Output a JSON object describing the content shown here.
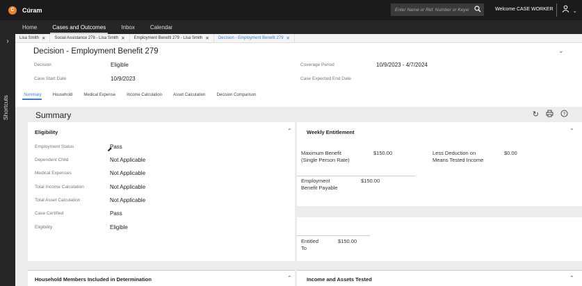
{
  "app": {
    "brand": "Cúram",
    "logo_letter": "C"
  },
  "search": {
    "placeholder": "Enter Name or Ref. Number or Keyw"
  },
  "user": {
    "welcome": "Welcome CASE WORKER",
    "icon": "user-icon"
  },
  "nav": {
    "items": [
      "Home",
      "Cases and Outcomes",
      "Inbox",
      "Calendar"
    ],
    "active": "Cases and Outcomes"
  },
  "rail": {
    "label": "Shortcuts"
  },
  "tabs": [
    {
      "label": "Lisa Smith"
    },
    {
      "label": "Social Assistance 278 - Lisa Smith"
    },
    {
      "label": "Employment Benefit 279 - Lisa Smith"
    },
    {
      "label": "Decision - Employment Benefit 279"
    }
  ],
  "header": {
    "title": "Decision - Employment Benefit 279",
    "decision_label": "Decision",
    "decision_value": "Eligible",
    "case_start_label": "Case Start Date",
    "case_start_value": "10/9/2023",
    "coverage_label": "Coverage Period",
    "coverage_value": "10/9/2023 - 4/7/2024",
    "expected_end_label": "Case Expected End Date"
  },
  "subtabs": [
    "Summary",
    "Household",
    "Medical Expense",
    "Income Calculation",
    "Asset Calculation",
    "Decision Comparison"
  ],
  "summary": {
    "title": "Summary"
  },
  "eligibility": {
    "title": "Eligibility",
    "rows": [
      {
        "label": "Employment Status",
        "value": "Pass"
      },
      {
        "label": "Dependent Child",
        "value": "Not Applicable"
      },
      {
        "label": "Medical Expenses",
        "value": "Not Applicable"
      },
      {
        "label": "Total Income Calculation",
        "value": "Not Applicable"
      },
      {
        "label": "Total Asset Calculation",
        "value": "Not Applicable"
      },
      {
        "label": "Case Certified",
        "value": "Pass"
      },
      {
        "label": "Eligibility",
        "value": "Eligible"
      }
    ]
  },
  "weekly": {
    "title": "Weekly Entitlement",
    "max_benefit_label_1": "Maximum Benefit",
    "max_benefit_label_2": "(Single Person Rate)",
    "max_benefit_value": "$150.00",
    "less_deduction_label_1": "Less Deduction on",
    "less_deduction_label_2": "Means Tested Income",
    "less_deduction_value": "$0.00",
    "payable_label_1": "Employment",
    "payable_label_2": "Benefit Payable",
    "payable_value": "$150.00",
    "entitled_label_1": "Entitled",
    "entitled_label_2": "To",
    "entitled_value": "$150.00"
  },
  "bottom": {
    "household_title": "Household Members Included in Determination",
    "income_title": "Income and Assets Tested"
  },
  "colors": {
    "accent": "#3a7bd5",
    "topbar": "#1b1b1b",
    "logo": "#e8822d"
  }
}
